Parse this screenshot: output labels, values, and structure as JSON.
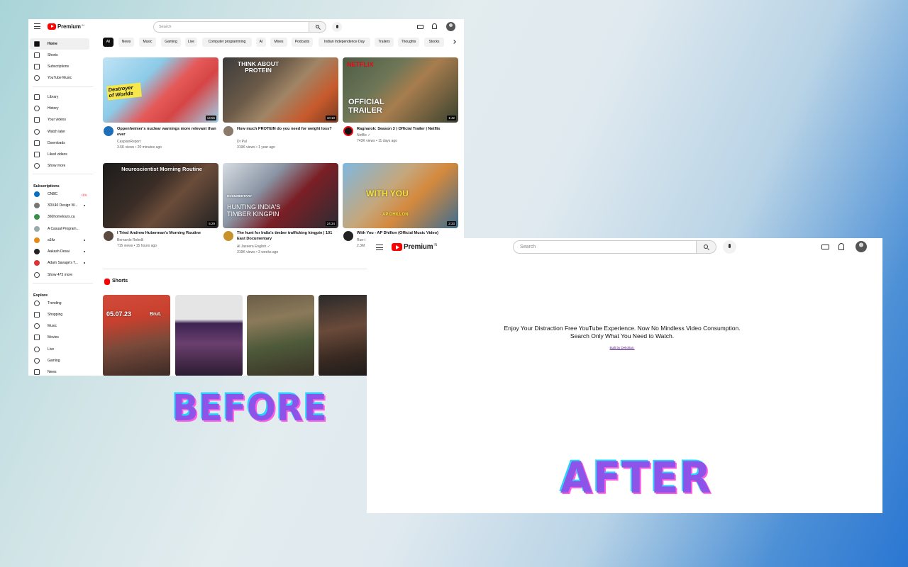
{
  "before": {
    "header": {
      "logo_word": "Premium",
      "logo_sup": "IN",
      "search_placeholder": "Search"
    },
    "sidebar": {
      "main_items": [
        "Home",
        "Shorts",
        "Subscriptions",
        "YouTube Music"
      ],
      "library_items": [
        "Library",
        "History",
        "Your videos",
        "Watch later",
        "Downloads",
        "Liked videos",
        "Show more"
      ],
      "subscriptions_heading": "Subscriptions",
      "subscriptions": [
        "CNBC",
        "3DX40 Design W...",
        "360homelours.ca",
        "A Casual Program...",
        "a1fiz",
        "Aakash Desai",
        "Adam Savage's T...",
        "Show 475 more"
      ],
      "explore_heading": "Explore",
      "explore_items": [
        "Trending",
        "Shopping",
        "Music",
        "Movies",
        "Live",
        "Gaming",
        "News"
      ]
    },
    "chips": [
      "All",
      "News",
      "Music",
      "Gaming",
      "Live",
      "Computer programming",
      "AI",
      "Mixes",
      "Podcasts",
      "Indian Independence Day",
      "Trailers",
      "Thoughts",
      "Stocks"
    ],
    "videos": [
      {
        "title": "Oppenheimer's nuclear warnings more relevant than ever",
        "channel": "CaspianReport",
        "meta": "3.6K views • 20 minutes ago",
        "duration": "14:55",
        "overlay": "Destroyer of Worlds"
      },
      {
        "title": "How much PROTEIN do you need for weight loss?",
        "channel": "Dr Pal",
        "meta": "319K views • 1 year ago",
        "duration": "10:10",
        "overlay": "THINK ABOUT PROTEIN"
      },
      {
        "title": "Ragnarok: Season 3 | Official Trailer | Netflix",
        "channel": "Netflix ✓",
        "meta": "743K views • 11 days ago",
        "duration": "1:42",
        "overlay": "OFFICIAL TRAILER",
        "brand": "NETFLIX"
      },
      {
        "title": "I Tried Andrew Huberman's Morning Routine",
        "channel": "Bernardo Rebolli",
        "meta": "715 views • 15 hours ago",
        "duration": "5:29",
        "overlay": "Neuroscientist Morning Routine"
      },
      {
        "title": "The hunt for India's timber trafficking kingpin | 101 East Documentary",
        "channel": "Al Jazeera English ✓",
        "meta": "319K views • 3 weeks ago",
        "duration": "24:34",
        "overlay": "HUNTING INDIA'S TIMBER KINGPIN",
        "tag": "DOCUMENTARY"
      },
      {
        "title": "With You - AP Dhillon (Official Music Video)",
        "channel": "Run-i",
        "meta": "2.3M",
        "duration": "2:33",
        "overlay": "WITH YOU",
        "credit": "AP DHILLON"
      }
    ],
    "shorts_title": "Shorts",
    "shorts": [
      {
        "overlay_date": "05.07.23",
        "overlay_brand": "Brut."
      },
      {},
      {},
      {}
    ]
  },
  "after": {
    "header": {
      "logo_word": "Premium",
      "logo_sup": "IN",
      "search_placeholder": "Search"
    },
    "message_line1": "Enjoy Your Distraction Free YouTube Experience. Now No Mindless Video Consumption.",
    "message_line2": "Search Only What You Need to Watch.",
    "link_text": "Built by Dekoltan."
  },
  "labels": {
    "before": "BEFORE",
    "after": "AFTER"
  },
  "colors": {
    "brand_red": "#ff0000",
    "label_fill": "#8e54e9",
    "label_cyan": "#29d3ff",
    "label_pink": "#ff5ce1",
    "link": "#551a8b"
  },
  "icons": [
    "menu-icon",
    "youtube-play-icon",
    "search-icon",
    "mic-icon",
    "create-icon",
    "bell-icon",
    "avatar",
    "home-icon",
    "shorts-icon",
    "subscriptions-icon",
    "music-icon",
    "library-icon",
    "history-icon",
    "your-videos-icon",
    "watch-later-icon",
    "downloads-icon",
    "liked-icon",
    "chevron-down-icon",
    "chevron-right-icon",
    "live-icon",
    "trending-icon",
    "shopping-icon",
    "movies-icon",
    "gaming-icon",
    "news-icon"
  ]
}
